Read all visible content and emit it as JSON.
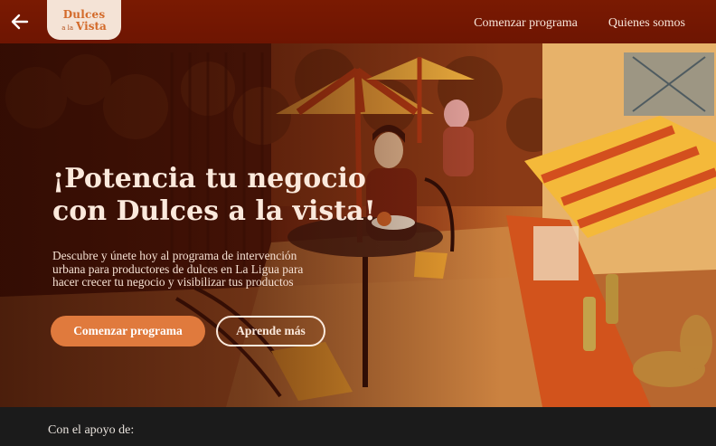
{
  "header": {
    "logo": {
      "line1": "Dulces",
      "small": "a la",
      "line2": "Vista"
    },
    "nav": [
      {
        "label": "Comenzar programa"
      },
      {
        "label": "Quienes somos"
      }
    ],
    "back_icon": "arrow-left-icon"
  },
  "hero": {
    "title_line1": "¡Potencia tu negocio",
    "title_line2": "con Dulces a la vista!",
    "description": "Descubre y únete hoy al programa de intervención urbana para productores de dulces en La Ligua para hacer crecer tu negocio y visibilizar tus productos",
    "primary_button": "Comenzar programa",
    "secondary_button": "Aprende más"
  },
  "support": {
    "label": "Con el apoyo de:"
  },
  "colors": {
    "header_bg": "#7a1a02",
    "logo_bg": "#f4e3d6",
    "logo_text": "#d36a2a",
    "primary_button": "#e07a3d",
    "footer_bg": "#1b1b1b"
  }
}
